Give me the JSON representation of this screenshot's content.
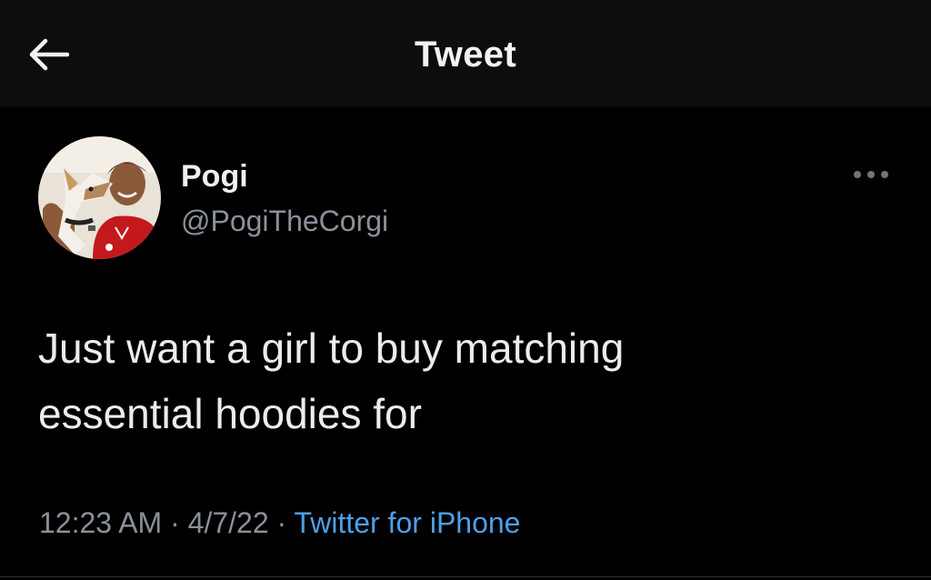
{
  "header": {
    "title": "Tweet",
    "back_icon": "arrow-left-icon"
  },
  "tweet": {
    "author": {
      "name": "Pogi",
      "handle": "@PogiTheCorgi",
      "avatar_description_icon": "avatar-photo"
    },
    "more_icon": "more-horizontal-icon",
    "text": "Just want a girl to buy matching\nessential hoodies for",
    "time": "12:23 AM",
    "separator": "·",
    "date": "4/7/22",
    "source": "Twitter for iPhone"
  },
  "colors": {
    "background": "#000000",
    "header_background": "#0d0d0d",
    "primary_text": "#ececec",
    "secondary_text": "#8b9199",
    "link": "#4ea0e8"
  }
}
